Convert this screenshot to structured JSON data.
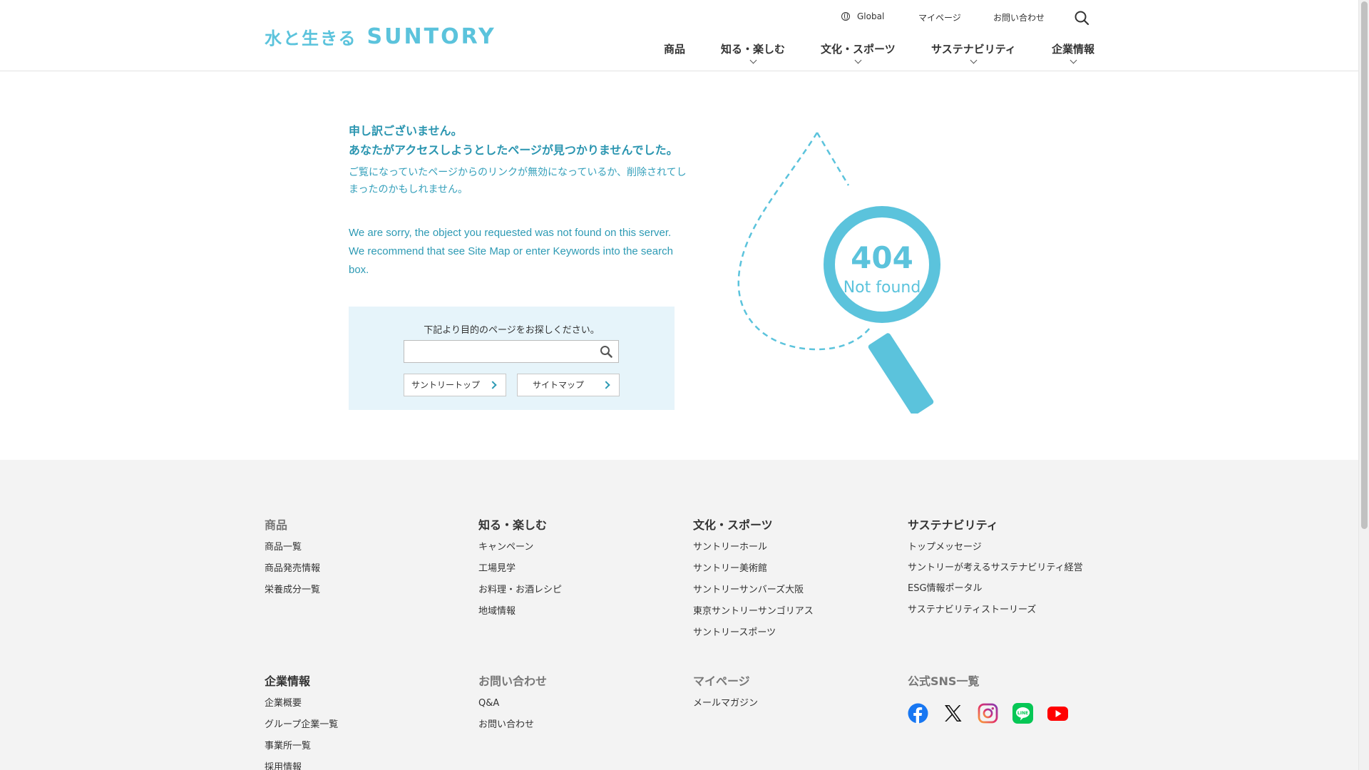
{
  "header": {
    "logo_jp": "水と生きる",
    "logo_en": "SUNTORY",
    "util": {
      "global": "Global",
      "mypage": "マイページ",
      "contact": "お問い合わせ"
    },
    "nav": [
      "商品",
      "知る・楽しむ",
      "文化・スポーツ",
      "サステナビリティ",
      "企業情報"
    ]
  },
  "main": {
    "heading1": "申し訳ございません。",
    "heading2": "あなたがアクセスしようとしたページが見つかりませんでした。",
    "sub": "ご覧になっていたページからのリンクが無効になっているか、削除されてしまったのかもしれません。",
    "en1": "We are sorry, the object you requested was not found on this server.",
    "en2": "We recommend that see Site Map or enter Keywords into the search box.",
    "search_lead": "下記より目的のページをお探しください。",
    "search_placeholder": "",
    "btn_top": "サントリートップ",
    "btn_sitemap": "サイトマップ",
    "code": "404",
    "not_found": "Not found"
  },
  "footer": {
    "products": {
      "title": "商品",
      "items": [
        "商品一覧",
        "商品発売情報",
        "栄養成分一覧"
      ]
    },
    "enjoy": {
      "title": "知る・楽しむ",
      "items": [
        "キャンペーン",
        "工場見学",
        "お料理・お酒レシピ",
        "地域情報"
      ]
    },
    "culture": {
      "title": "文化・スポーツ",
      "items": [
        "サントリーホール",
        "サントリー美術館",
        "サントリーサンバーズ大阪",
        "東京サントリーサンゴリアス",
        "サントリースポーツ"
      ]
    },
    "sustain": {
      "title": "サステナビリティ",
      "items": [
        "トップメッセージ",
        "サントリーが考えるサステナビリティ経営",
        "ESG情報ポータル",
        "サステナビリティストーリーズ"
      ]
    },
    "corp": {
      "title": "企業情報",
      "items": [
        "企業概要",
        "グループ企業一覧",
        "事業所一覧",
        "採用情報"
      ]
    },
    "contact": {
      "title": "お問い合わせ",
      "items": [
        "Q&A",
        "お問い合わせ"
      ]
    },
    "mypage": {
      "title": "マイページ",
      "items": [
        "メールマガジン"
      ]
    },
    "sns": {
      "title": "公式SNS一覧"
    }
  },
  "colors": {
    "brand": "#5bc3dc",
    "text_accent": "#2d9ab4",
    "search_bg": "#e6f4fa",
    "footer_bg": "#f3f3f3"
  },
  "icons": [
    "globe-icon",
    "search-icon",
    "chevron-down-icon",
    "facebook-icon",
    "x-icon",
    "instagram-icon",
    "line-icon",
    "youtube-icon"
  ]
}
